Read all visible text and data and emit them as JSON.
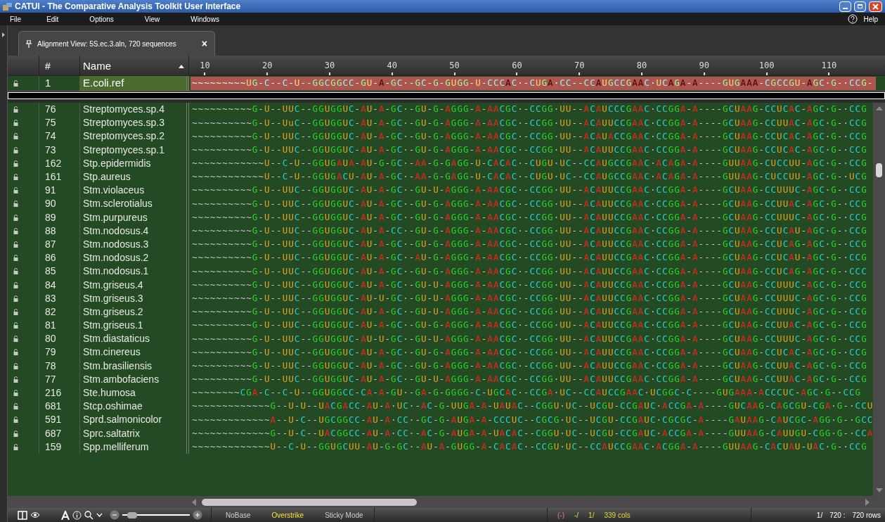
{
  "window": {
    "title": "CATUI - The Comparative Analysis Toolkit User Interface"
  },
  "menu": [
    "File",
    "Edit",
    "Options",
    "View",
    "Windows"
  ],
  "help": "Help",
  "tab": {
    "label": "Alignment View: 5S.ec.3.aln, 720 sequences",
    "close": "×"
  },
  "columns": {
    "number": "#",
    "name": "Name"
  },
  "ruler": [
    "10",
    "20",
    "30",
    "40",
    "50",
    "60",
    "70",
    "80",
    "90",
    "100",
    "110"
  ],
  "reference": {
    "number": "1",
    "name": "E.coli.ref",
    "sequence": "~~~~~~~~~UG-C--C-U--GGCGGCC-GU-A-GC·-GC-G-GUGG-U-CCCAC·-CUGA·CC--CCAUGCCGAAC·UCAGA-A----GUGAAA-CGCCGU-AGC·G-·CCG-"
  },
  "rows": [
    {
      "number": "76",
      "name": "Streptomyces.sp.4",
      "sequence": "~~~~~~~~~~G-U--UUC--GGUGGUC-AU-A-GC·-GU-G-AGGG-A-AACGC·-CCGG·UU--ACAUCCCGAAC·CCGGA-A----GCUAAG-CCUCAC-AGC·G-·CCG"
    },
    {
      "number": "75",
      "name": "Streptomyces.sp.3",
      "sequence": "~~~~~~~~~~G-U--UuC--GGUGGUC-AU-A-GC·-GU-G-AGGG-A-AACGC·-CCGG·UU--ACAUUCCGAAC·CCGGA-A----GCUAAG-CCUUAC-AGC·G-·CCG"
    },
    {
      "number": "74",
      "name": "Streptomyces.sp.2",
      "sequence": "~~~~~~~~~~G-U--UUC--GGUGGUC-AU-A-GC·-GU-G-AGGG-A-AACGC·-CCGG·UU--ACAUACCGAAC·CCGGA-A----GCUAAG-CCUCAC-AGC·G-·CCG"
    },
    {
      "number": "73",
      "name": "Streptomyces.sp.1",
      "sequence": "~~~~~~~~~~G-U--UUC--GGUGGUC-AU-A-GC·-GU-G-AGGG-A-AACGC·-CCGG·UU--ACAUUCCGAAC·CCGGA-A----GCUAAG-CCUCAC-AGC·G-·CCG"
    },
    {
      "number": "162",
      "name": "Stp.epidermidis",
      "sequence": "~~~~~~~~~~~~U--C-U--GGUGAUA-AU-G-GC·-AA-G-GAGG-U-CACAC·-CUGU·UC--CCAUGCCGAAC·ACAGA-A----GUUAAG-CUCCUU-AGC·G-·CCG"
    },
    {
      "number": "161",
      "name": "Stp.aureus",
      "sequence": "~~~~~~~~~~~~U--C-U--GGUGACU-AU-A-GC·-AA-G-GAGG-U-CACAC·-CUGU·UC--CCAUGCCGAAC·ACAGA-A----GUUAAG-CUCCUU-AGC·G-·UCG"
    },
    {
      "number": "91",
      "name": "Stm.violaceus",
      "sequence": "~~~~~~~~~~G-U--UUC--GGUGGUC-AU-A-GC·-GU-U-AGGG-A-AACGC·-CCGG·UU--ACAUUCCGAAC·CCGGA-A----GCUAAG-CCUUUC-AGC·G-·CCG"
    },
    {
      "number": "90",
      "name": "Stm.sclerotialus",
      "sequence": "~~~~~~~~~~G-U--UUC--GGUGGUC-AU-A-GC·-GU-G-AGGG-A-AACGC·-CCGG·UU--ACAUUCCGAAC·CCGGA-A----GCUAAG-CCUUAC-AGC·G-·CCG"
    },
    {
      "number": "89",
      "name": "Stm.purpureus",
      "sequence": "~~~~~~~~~~G-U--UUC--GGUGGUC-AU-A-GC·-GU-G-AGGG-A-AACGC·-CCGG·UU--ACAUUCCGAAC·CCGGA-A----GCUAAG-CCUUUC-AGC·G-·CCG"
    },
    {
      "number": "88",
      "name": "Stm.nodosus.4",
      "sequence": "~~~~~~~~~~G-U--UUC--GGUGGUC-AU-A-CC·-GU-G-AGGG-A-AACGC·-CCGG·UU--ACAUUCCGAAC·CCGGA-A----GCUAAG-CCUCAU-AGC·G-·CCG"
    },
    {
      "number": "87",
      "name": "Stm.nodosus.3",
      "sequence": "~~~~~~~~~~G-U--UUC--GGUGGUC-AU-A-GC·-GU-G-AGGG-A-AACGC·-CCGG·UU--ACAUUCCGAAC·CCGGA-A----GCUAAG-CCUCAG-AGC·G-·CCG"
    },
    {
      "number": "86",
      "name": "Stm.nodosus.2",
      "sequence": "~~~~~~~~~~G-U--UUC--GGUGGUC-AU-A-GC·-AU-G-AGGG-A-AACGC·-CCGG·UU--ACAUUCCGAAC·CCGGA-A----GCUAAG-CCUCAU-AGC·G-·CCG"
    },
    {
      "number": "85",
      "name": "Stm.nodosus.1",
      "sequence": "~~~~~~~~~~G-U--UUC--GGUGGUC-AU-A-GC·-GU-G-AGGG-A-AACGC·-CCGG·UU--ACAUUCCGAAC·CCGGA-A----GCUAAG-CCUCAG-AGC·G-·CCC"
    },
    {
      "number": "84",
      "name": "Stm.griseus.4",
      "sequence": "~~~~~~~~~~G-U--UUC--GGUGGUC-AU-A-GC·-GU-U-AGGG-A-AACGC·-CCGG·UU--ACAUUCCGAAC·CCGGA-A----GCUAAG-CCUUUC-AGC·G-·CCG"
    },
    {
      "number": "83",
      "name": "Stm.griseus.3",
      "sequence": "~~~~~~~~~~G-U--UUC--GGUGGUC-AU-U-GC·-GU-U-AGGG-A-AACGC·-CCGG·UU--ACAUUCCGAAC·CCGGA-A----GCUAAG-CCUUUC-AGC·G-·CCG"
    },
    {
      "number": "82",
      "name": "Stm.griseus.2",
      "sequence": "~~~~~~~~~~G-U--UUC--GGUGGUC-AU-A-GC·-GU-U-AGGG-A-AACGC·-CCGG·UU--ACAUUCCGAAC·CCGGA-A----GCUAAG-CCUUUC-AGC·G-·CCG"
    },
    {
      "number": "81",
      "name": "Stm.griseus.1",
      "sequence": "~~~~~~~~~~G-U--UUC--GGUGGUC-AU-A-GC·-GU-G-AGGG-A-AACGC·-CCGG·UU--ACAUUCCGAAC·CCGGA-A----GCUAAG-CCUUAC-AGC·G-·CCG"
    },
    {
      "number": "80",
      "name": "Stm.diastaticus",
      "sequence": "~~~~~~~~~~G-U--UUC--GGUGGUC-AU-U-GC·-GU-U-AGGG-A-AACGC·-CCGG·UU--ACAUUCCGAAC·CCGGA-A----GCUAAG-CCUUUC-AGC·G-·CCG"
    },
    {
      "number": "79",
      "name": "Stm.cinereus",
      "sequence": "~~~~~~~~~~G-U--UUC--GGUGGUC-AU-A-GC·-GU-G-AGGG-A-AACGC·-CCGG·UU--ACAUUCCGAAC·CCGGA-A----GCUAAG-CCUCAC-AGC·G-·CCG"
    },
    {
      "number": "78",
      "name": "Stm.brasiliensis",
      "sequence": "~~~~~~~~~~G-U--UUC--GGUGGUC-AU-A-GC·-GU-G-AGGG-A-AACGC·-CCGG·UU--ACAUUCCGAAC·CCGGA-A----GCUAAG-CCUUAC-AGC·G-·CCG"
    },
    {
      "number": "77",
      "name": "Stm.ambofaciens",
      "sequence": "~~~~~~~~~~G-U--UUC--GGUGGUC-AU-A-GC·-GU-U-AGGG-A-AACGC·-CCGG·UU--ACAUUCCGAAC·CCGGA-A----GCUAAG-CCUUAC-AGC·G-·CCG"
    },
    {
      "number": "216",
      "name": "Ste.humosa",
      "sequence": "~~~~~~~~CGA-C--C-U--GGUGGCC-CA-A-GU·-GA-G-GGGG-C-UGCAC·-CCGA·UC--CCAUCCGAAC·UCGGC-C----GUGAAA-ACCCUC-AGC·G-·CCG"
    },
    {
      "number": "681",
      "name": "Stcp.oshimae",
      "sequence": "~~~~~~~~~~~~~G--U-U--UACGACC-AU-A·UC·-AC-G-UUGA-A-UAUAC--CGGU·UC--UCGU-CCGAUC·ACCGA-A----GUCAAG-CAGCGU-CGA·G-·CCU"
    },
    {
      "number": "591",
      "name": "Sprd.salmonicolor",
      "sequence": "~~~~~~~~~~~~~A--U-C--UGCGGCC-AU-A·CC·-GC-G-AUGA-A-CCCUC--CGCG·UC--UCGU-CCGAUC·CGCGC-A----GAUAAG-CAUCGC-AGG·G-·GCC"
    },
    {
      "number": "687",
      "name": "Sprc.saltatrix",
      "sequence": "~~~~~~~~~~~~~G--U-C--UACGGCC-AU-A·CC·-AC-G-AUGA-A-UACAC--CGGU·UC--UCGU-CCGAUC·ACCGA-A----GUUAAG-CAUUGU-CGG·G-·CCA"
    },
    {
      "number": "159",
      "name": "Spp.melliferum",
      "sequence": "~~~~~~~~~~~~~U--C-U--GGUGCUU-AU-G-GC·-AU-A-GUGG-A-CACAC·-CCGU·UC--CCAUCCGAAC·ACGGA-A----GUUAAG-CACUAU-UAC·G-·CCG"
    }
  ],
  "zoom": {
    "level": 0.15
  },
  "status": {
    "modes": [
      {
        "label": "NoBase",
        "active": false
      },
      {
        "label": "Overstrike",
        "active": true
      },
      {
        "label": "Sticky Mode",
        "active": false
      }
    ],
    "error": "(-)",
    "position": [
      "-/",
      "1/",
      "339 cols"
    ],
    "rows_info": [
      "1/",
      "720 :",
      "720 rows"
    ]
  }
}
